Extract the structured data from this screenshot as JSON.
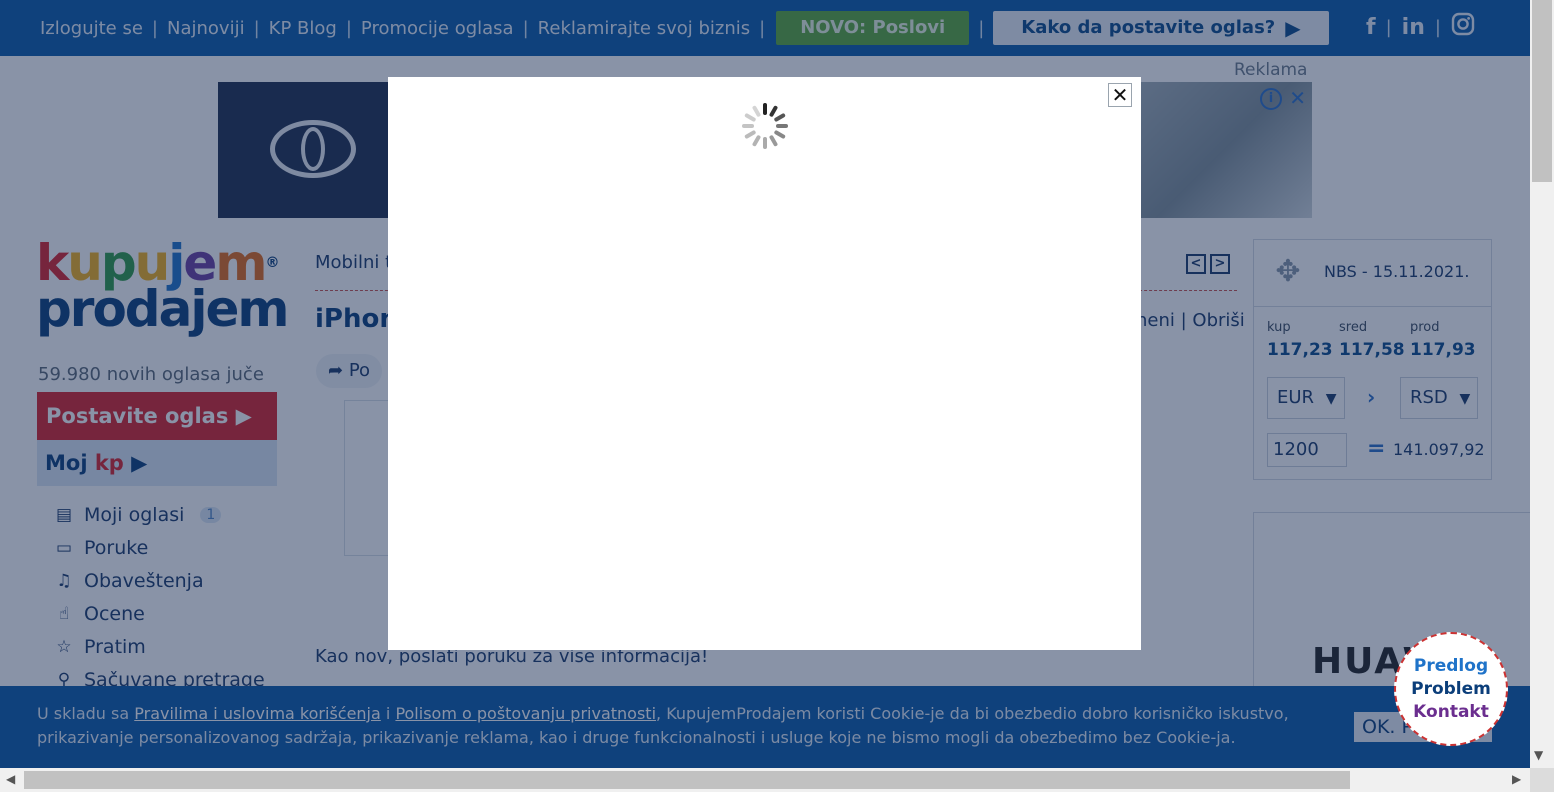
{
  "topbar": {
    "links": [
      "Izlogujte se",
      "Najnoviji",
      "KP Blog",
      "Promocije oglasa",
      "Reklamirajte svoj biznis"
    ],
    "separator": "|",
    "novo_label": "NOVO: Poslovi",
    "kako_label": "Kako da postavite oglas?",
    "social": {
      "facebook": "f",
      "linkedin": "in",
      "instagram_icon": "instagram-icon"
    }
  },
  "ad": {
    "label": "Reklama",
    "info": "i",
    "close": "✕",
    "brand": "HUAWEI"
  },
  "logo": {
    "line1": "kupujem",
    "line2": "prodajem",
    "reg": "®"
  },
  "sidebar": {
    "new_ads": "59.980 novih oglasa juče",
    "post_label": "Postavite oglas ▶",
    "moj_prefix": "Moj ",
    "moj_kp": "kp",
    "moj_arrow": " ▶",
    "items": [
      {
        "label": "Moji oglasi",
        "badge": "1",
        "icon": "list-icon"
      },
      {
        "label": "Poruke",
        "icon": "chat-icon"
      },
      {
        "label": "Obaveštenja",
        "icon": "bell-icon"
      },
      {
        "label": "Ocene",
        "icon": "thumbs-up-icon"
      },
      {
        "label": "Pratim",
        "icon": "star-icon"
      },
      {
        "label": "Sačuvane pretrage",
        "icon": "saved-search-icon"
      }
    ]
  },
  "main": {
    "breadcrumb": "Mobilni t",
    "title": "iPhon",
    "edit_links": "neni | Obriši",
    "share_label": "Po",
    "description": "Kao nov, poslati poruku za vise informacija!"
  },
  "currency": {
    "date": "NBS - 15.11.2021.",
    "labels": [
      "kup",
      "sred",
      "prod"
    ],
    "values": [
      "117,23",
      "117,58",
      "117,93"
    ],
    "from": "EUR",
    "to": "RSD",
    "amount": "1200",
    "equals": "=",
    "result": "141.097,92"
  },
  "modal": {
    "close": "✕"
  },
  "cookie": {
    "pre": "U skladu sa ",
    "link1": "Pravilima i uslovima korišćenja",
    "mid": " i ",
    "link2": "Polisom o poštovanju privatnosti",
    "post": ", KupujemProdajem koristi Cookie-je da bi obezbedio dobro korisničko iskustvo, prikazivanje personalizovanog sadržaja, prikazivanje reklama, kao i druge funkcionalnosti i usluge koje ne bismo mogli da obezbedimo bez Cookie-ja.",
    "ok_label": "OK. Pr"
  },
  "feedback": {
    "line1": "Predlog",
    "line2": "Problem",
    "line3": "Kontakt"
  }
}
